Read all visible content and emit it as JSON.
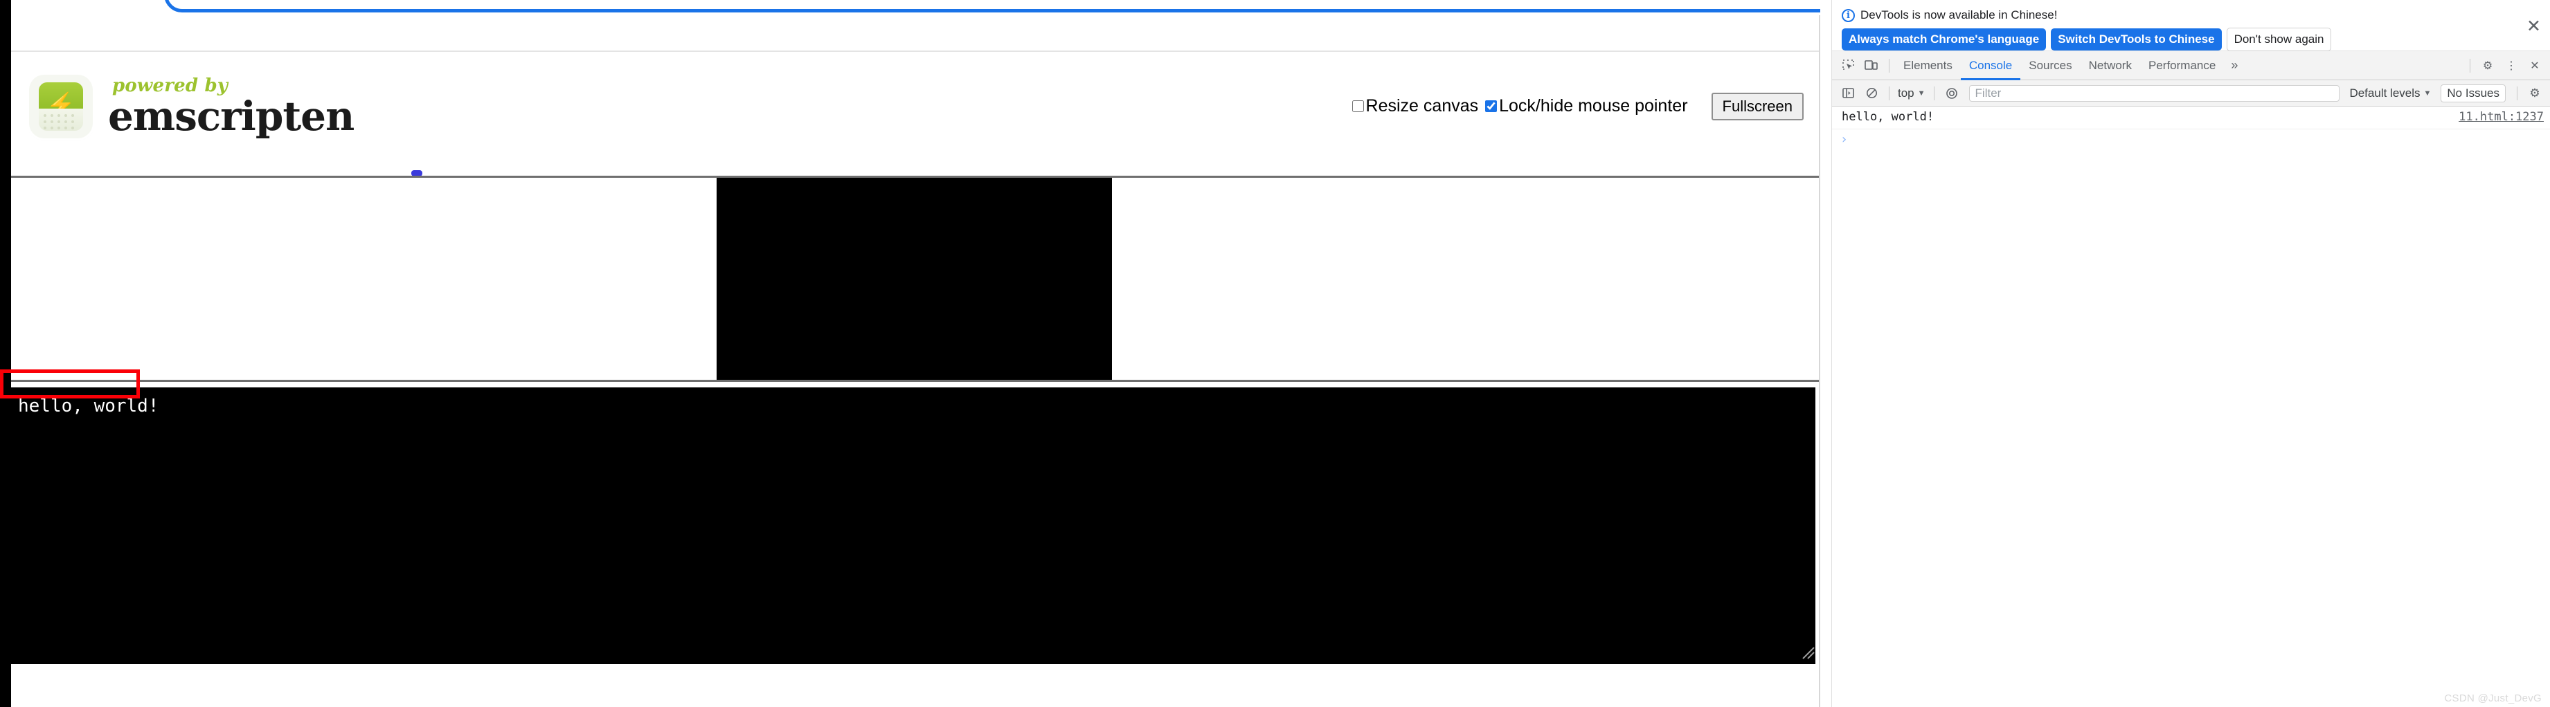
{
  "browser": {
    "omnibox_focus_ring_color": "#1a73e8"
  },
  "page": {
    "header": {
      "logo_alt": "powered by emscripten",
      "powered_by_text": "powered by",
      "product_name": "emscripten",
      "controls": {
        "resize_canvas_label": "Resize canvas",
        "resize_canvas_checked": false,
        "lock_pointer_label": "Lock/hide mouse pointer",
        "lock_pointer_checked": true,
        "fullscreen_button": "Fullscreen"
      }
    },
    "progress": {
      "value_visible": true
    },
    "canvas": {
      "background": "#000000"
    },
    "output": {
      "text": "hello, world!",
      "background": "#000000",
      "color": "#ffffff"
    }
  },
  "annotations": {
    "highlight_color": "#fb0007",
    "page_output_box_label": "hello, world!",
    "console_box_label": "hello, world!"
  },
  "devtools": {
    "banner": {
      "message": "DevTools is now available in Chinese!",
      "primary_button": "Always match Chrome's language",
      "secondary_button": "Switch DevTools to Chinese",
      "dismiss_button": "Don't show again",
      "close_glyph": "✕",
      "info_glyph": "i",
      "primary_color": "#1a73e8"
    },
    "tabbar": {
      "inspect_icon": "inspect-element-icon",
      "device_icon": "device-toolbar-icon",
      "tabs": [
        {
          "label": "Elements",
          "active": false
        },
        {
          "label": "Console",
          "active": true
        },
        {
          "label": "Sources",
          "active": false
        },
        {
          "label": "Network",
          "active": false
        },
        {
          "label": "Performance",
          "active": false
        }
      ],
      "overflow_glyph": "»",
      "settings_glyph": "⚙",
      "kebab_glyph": "⋮",
      "close_glyph": "✕"
    },
    "console_toolbar": {
      "sidebar_glyph": "▣",
      "clear_glyph": "⊘",
      "context": "top",
      "context_caret": "▼",
      "eye_glyph": "◎",
      "filter_value": "",
      "filter_placeholder": "Filter",
      "levels_label": "Default levels",
      "levels_caret": "▼",
      "issues_label": "No Issues",
      "settings_glyph": "⚙"
    },
    "messages": [
      {
        "text": "hello, world!",
        "source": "11.html:1237"
      }
    ],
    "prompt_caret": "›"
  },
  "watermark": {
    "text": "CSDN @Just_DevG"
  }
}
